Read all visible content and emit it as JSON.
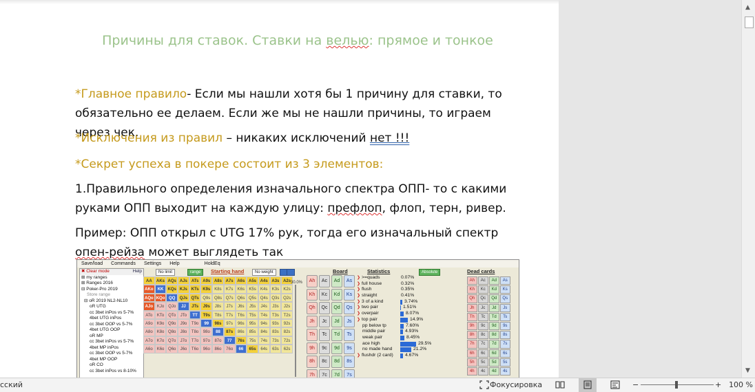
{
  "document": {
    "title_part1": "Причины для ставок. Ставки на ",
    "title_squiggle": "велью",
    "title_part2": ": прямое и тонкое",
    "p1_gold": "*Главное правило",
    "p1_rest": "- Если мы нашли хотя бы 1 причину для ставки, то обязательно ее делаем. Если же мы не нашли причины, то играем через чек.",
    "p2_gold": "*Исключения из правил",
    "p2_rest": " – никаких исключений ",
    "p2_underlined": "нет !!!",
    "p3_gold": "*Секрет успеха в покере состоит из 3 элементов:",
    "p4_text": "1.Правильного определения изначального спектра ОПП- то с какими руками ОПП выходит на каждую улицу: ",
    "p4_wavy": "префлоп",
    "p4_rest": ", флоп, терн, ривер.",
    "p5_text": "Пример: ОПП открыл с UTG 17% рук, тогда его изначальный спектр ",
    "p5_wavy": "опен-рейза",
    "p5_rest": " может выглядеть так"
  },
  "poker_app": {
    "menu": [
      "Save/load",
      "Commands",
      "Settings",
      "Help",
      "HoldEq"
    ],
    "left_panel": {
      "clear_mode": "Clear mode",
      "help": "Help",
      "tree": [
        "my ranges",
        "Ranges 2016",
        "Poker-Pro 2019",
        "Store range",
        "oR 2019 NL2-NL10",
        "oR UTG",
        "cc 3bet inPos vs 5-7%",
        "4bet UTG inPos",
        "cc 3bet OOP vs 5-7%",
        "4bet UTG OOP",
        "oR MP",
        "cc 3bet inPos vs 5-7%",
        "4bet MP inPos",
        "cc 3bet OOP vs 5-7%",
        "4bet MP OOP",
        "oR CO",
        "cc 3bet inPos vs 8-10%"
      ]
    },
    "top_controls": {
      "no_limit": "No limit",
      "range": "range",
      "starting_hand": "Starting hand",
      "no_weight": "No weight",
      "board": "Board",
      "statistics": "Statistics",
      "absolute": "Absolute",
      "dead_cards": "Dead cards",
      "percent": "30.0%"
    },
    "hand_grid": [
      [
        "AA",
        "AKs",
        "AQs",
        "AJs",
        "ATs",
        "A9s",
        "A8s",
        "A7s",
        "A6s",
        "A5s",
        "A4s",
        "A3s",
        "A2s"
      ],
      [
        "AKo",
        "KK",
        "KQs",
        "KJs",
        "KTs",
        "K9s",
        "K8s",
        "K7s",
        "K6s",
        "K5s",
        "K4s",
        "K3s",
        "K2s"
      ],
      [
        "AQo",
        "KQo",
        "QQ",
        "QJs",
        "QTs",
        "Q9s",
        "Q8s",
        "Q7s",
        "Q6s",
        "Q5s",
        "Q4s",
        "Q3s",
        "Q2s"
      ],
      [
        "AJo",
        "KJo",
        "QJo",
        "JJ",
        "JTs",
        "J9s",
        "J8s",
        "J7s",
        "J6s",
        "J5s",
        "J4s",
        "J3s",
        "J2s"
      ],
      [
        "ATo",
        "KTo",
        "QTo",
        "JTo",
        "TT",
        "T9s",
        "T8s",
        "T7s",
        "T6s",
        "T5s",
        "T4s",
        "T3s",
        "T2s"
      ],
      [
        "A9o",
        "K9o",
        "Q9o",
        "J9o",
        "T9o",
        "99",
        "98s",
        "97s",
        "96s",
        "95s",
        "94s",
        "93s",
        "92s"
      ],
      [
        "A8o",
        "K8o",
        "Q8o",
        "J8o",
        "T8o",
        "98o",
        "88",
        "87s",
        "86s",
        "85s",
        "84s",
        "83s",
        "82s"
      ],
      [
        "A7o",
        "K7o",
        "Q7o",
        "J7o",
        "T7o",
        "97o",
        "87o",
        "77",
        "76s",
        "75s",
        "74s",
        "73s",
        "72s"
      ],
      [
        "A6o",
        "K6o",
        "Q6o",
        "J6o",
        "T6o",
        "96o",
        "86o",
        "76o",
        "66",
        "65s",
        "64s",
        "63s",
        "62s"
      ]
    ],
    "board_cards": [
      [
        "Ah",
        "Ac",
        "Ad",
        "As"
      ],
      [
        "Kh",
        "Kc",
        "Kd",
        "Ks"
      ],
      [
        "Qh",
        "Qc",
        "Qd",
        "Qs"
      ],
      [
        "Jh",
        "Jc",
        "Jd",
        "Js"
      ],
      [
        "Th",
        "Tc",
        "Td",
        "Ts"
      ],
      [
        "9h",
        "9c",
        "9d",
        "9s"
      ],
      [
        "8h",
        "8c",
        "8d",
        "8s"
      ],
      [
        "7h",
        "7c",
        "7d",
        "7s"
      ]
    ],
    "statistics": [
      {
        "label": ">=quads",
        "value": "0.07%",
        "bar": 0
      },
      {
        "label": "full house",
        "value": "0.32%",
        "bar": 0
      },
      {
        "label": "flush",
        "value": "0.35%",
        "bar": 0
      },
      {
        "label": "straight",
        "value": "0.41%",
        "bar": 0
      },
      {
        "label": "3 of a kind",
        "value": "3.74%",
        "bar": 0.03
      },
      {
        "label": "two pair",
        "value": "1.51%",
        "bar": 0.01
      },
      {
        "label": "overpair",
        "value": "8.07%",
        "bar": 0.06
      },
      {
        "label": "top pair",
        "value": "14.9%",
        "bar": 0.12
      },
      {
        "label": "pp below tp",
        "value": "7.60%",
        "bar": 0.06
      },
      {
        "label": "middle pair",
        "value": "4.93%",
        "bar": 0.04
      },
      {
        "label": "weak pair",
        "value": "8.45%",
        "bar": 0.07
      },
      {
        "label": "ace high",
        "value": "29.5%",
        "bar": 0.25
      },
      {
        "label": "no made hand",
        "value": "21.2%",
        "bar": 0.18
      },
      {
        "label": "flushdr (2 card)",
        "value": "4.67%",
        "bar": 0.04
      }
    ],
    "dead_cards": [
      [
        "Ah",
        "Ac",
        "Ad",
        "As"
      ],
      [
        "Kh",
        "Kc",
        "Kd",
        "Ks"
      ],
      [
        "Qh",
        "Qc",
        "Qd",
        "Qs"
      ],
      [
        "Jh",
        "Jc",
        "Jd",
        "Js"
      ],
      [
        "Th",
        "Tc",
        "Td",
        "Ts"
      ],
      [
        "9h",
        "9c",
        "9d",
        "9s"
      ],
      [
        "8h",
        "8c",
        "8d",
        "8s"
      ],
      [
        "7h",
        "7c",
        "7d",
        "7s"
      ],
      [
        "6h",
        "6c",
        "6d",
        "6s"
      ],
      [
        "5h",
        "5c",
        "5d",
        "5s"
      ],
      [
        "4h",
        "4c",
        "4d",
        "4s"
      ]
    ]
  },
  "statusbar": {
    "language": "сский",
    "focus": "Фокусировка",
    "zoom_minus": "−",
    "zoom_plus": "+",
    "zoom": "100 %"
  }
}
